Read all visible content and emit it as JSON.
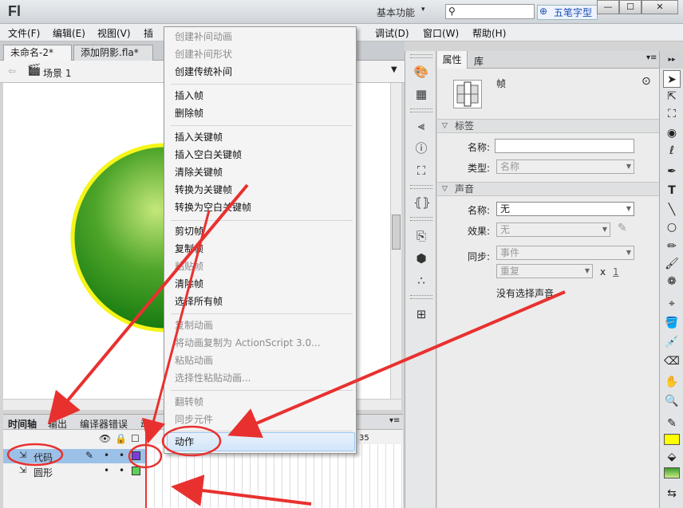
{
  "app": {
    "logo": "Fl",
    "workspace": "基本功能",
    "search_placeholder": "",
    "ime_label": "五笔字型",
    "min_label": "—",
    "max_label": "☐",
    "close_label": "✕"
  },
  "menubar": [
    "文件(F)",
    "编辑(E)",
    "视图(V)",
    "插",
    "调试(D)",
    "窗口(W)",
    "帮助(H)"
  ],
  "doc_tabs": [
    {
      "label": "未命名-2*",
      "close": "×"
    },
    {
      "label": "添加阴影.fla*",
      "close": "×"
    }
  ],
  "scene": {
    "label": "场景 1"
  },
  "timeline": {
    "tabs": [
      "时间轴",
      "输出",
      "编译器错误",
      "动"
    ],
    "frame_number": "35",
    "layers": [
      {
        "name": "代码",
        "selected": true
      },
      {
        "name": "圆形",
        "selected": false
      }
    ]
  },
  "context_menu": {
    "groups": [
      [
        {
          "label": "创建补间动画",
          "enabled": false
        },
        {
          "label": "创建补间形状",
          "enabled": false
        },
        {
          "label": "创建传统补间",
          "enabled": true
        }
      ],
      [
        {
          "label": "插入帧",
          "enabled": true
        },
        {
          "label": "删除帧",
          "enabled": true
        }
      ],
      [
        {
          "label": "插入关键帧",
          "enabled": true
        },
        {
          "label": "插入空白关键帧",
          "enabled": true
        },
        {
          "label": "清除关键帧",
          "enabled": true
        },
        {
          "label": "转换为关键帧",
          "enabled": true
        },
        {
          "label": "转换为空白关键帧",
          "enabled": true
        }
      ],
      [
        {
          "label": "剪切帧",
          "enabled": true
        },
        {
          "label": "复制帧",
          "enabled": true
        },
        {
          "label": "粘贴帧",
          "enabled": false
        },
        {
          "label": "清除帧",
          "enabled": true
        },
        {
          "label": "选择所有帧",
          "enabled": true
        }
      ],
      [
        {
          "label": "复制动画",
          "enabled": false
        },
        {
          "label": "将动画复制为 ActionScript 3.0...",
          "enabled": false
        },
        {
          "label": "粘贴动画",
          "enabled": false
        },
        {
          "label": "选择性粘贴动画...",
          "enabled": false
        }
      ],
      [
        {
          "label": "翻转帧",
          "enabled": false
        },
        {
          "label": "同步元件",
          "enabled": false
        }
      ],
      [
        {
          "label": "动作",
          "enabled": true,
          "highlighted": true
        }
      ]
    ]
  },
  "properties": {
    "tabs": [
      "属性",
      "库"
    ],
    "kind": "帧",
    "label_section": "标签",
    "name_label": "名称:",
    "type_label": "类型:",
    "type_value": "名称",
    "sound_section": "声音",
    "sound_name_label": "名称:",
    "sound_name_value": "无",
    "effect_label": "效果:",
    "effect_value": "无",
    "sync_label": "同步:",
    "sync_value": "事件",
    "repeat_value": "重复",
    "repeat_x": "x",
    "repeat_count": "1",
    "no_sound": "没有选择声音"
  },
  "colors": {
    "annotation": "#e8312f",
    "stroke_swatch": "#333333",
    "fill_swatch": "#ffff00",
    "circle_fill": "#3f9a1f",
    "circle_stroke": "#f5f51a"
  }
}
